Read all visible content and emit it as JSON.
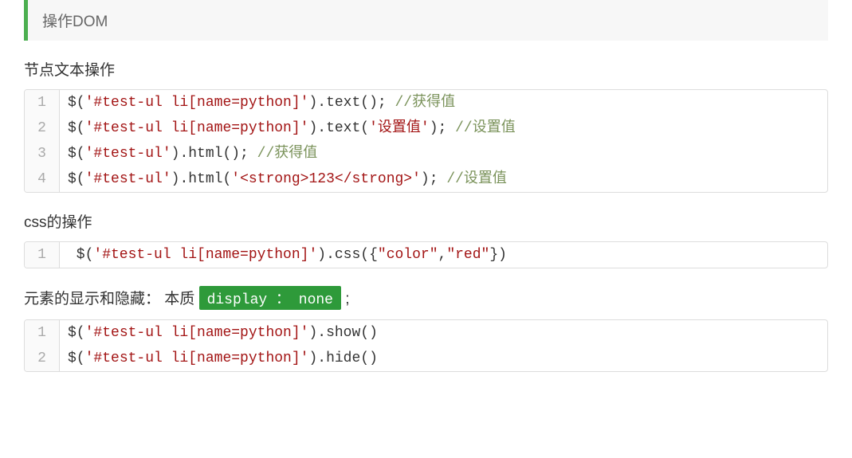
{
  "quote": "操作DOM",
  "section1": {
    "heading": "节点文本操作",
    "code": [
      {
        "line": "1",
        "tokens": [
          {
            "t": "$(",
            "c": "fn"
          },
          {
            "t": "'#test-ul li[name=python]'",
            "c": "str"
          },
          {
            "t": ").text(); ",
            "c": "fn"
          },
          {
            "t": "//获得值",
            "c": "cmt"
          }
        ]
      },
      {
        "line": "2",
        "tokens": [
          {
            "t": "$(",
            "c": "fn"
          },
          {
            "t": "'#test-ul li[name=python]'",
            "c": "str"
          },
          {
            "t": ").text(",
            "c": "fn"
          },
          {
            "t": "'设置值'",
            "c": "str"
          },
          {
            "t": "); ",
            "c": "fn"
          },
          {
            "t": "//设置值",
            "c": "cmt"
          }
        ]
      },
      {
        "line": "3",
        "tokens": [
          {
            "t": "$(",
            "c": "fn"
          },
          {
            "t": "'#test-ul'",
            "c": "str"
          },
          {
            "t": ").html(); ",
            "c": "fn"
          },
          {
            "t": "//获得值",
            "c": "cmt"
          }
        ]
      },
      {
        "line": "4",
        "tokens": [
          {
            "t": "$(",
            "c": "fn"
          },
          {
            "t": "'#test-ul'",
            "c": "str"
          },
          {
            "t": ").html(",
            "c": "fn"
          },
          {
            "t": "'<strong>123</strong>'",
            "c": "str"
          },
          {
            "t": "); ",
            "c": "fn"
          },
          {
            "t": "//设置值",
            "c": "cmt"
          }
        ]
      }
    ]
  },
  "section2": {
    "heading": "css的操作",
    "code": [
      {
        "line": "1",
        "tokens": [
          {
            "t": " $(",
            "c": "fn"
          },
          {
            "t": "'#test-ul li[name=python]'",
            "c": "str"
          },
          {
            "t": ").css({",
            "c": "fn"
          },
          {
            "t": "\"color\"",
            "c": "str"
          },
          {
            "t": ",",
            "c": "fn"
          },
          {
            "t": "\"red\"",
            "c": "str"
          },
          {
            "t": "})",
            "c": "fn"
          }
        ]
      }
    ]
  },
  "section3": {
    "heading_before": "元素的显示和隐藏： 本质 ",
    "badge": "display ： none",
    "heading_after": " ;",
    "code": [
      {
        "line": "1",
        "tokens": [
          {
            "t": "$(",
            "c": "fn"
          },
          {
            "t": "'#test-ul li[name=python]'",
            "c": "str"
          },
          {
            "t": ").show()",
            "c": "fn"
          }
        ]
      },
      {
        "line": "2",
        "tokens": [
          {
            "t": "$(",
            "c": "fn"
          },
          {
            "t": "'#test-ul li[name=python]'",
            "c": "str"
          },
          {
            "t": ").hide()",
            "c": "fn"
          }
        ]
      }
    ]
  }
}
